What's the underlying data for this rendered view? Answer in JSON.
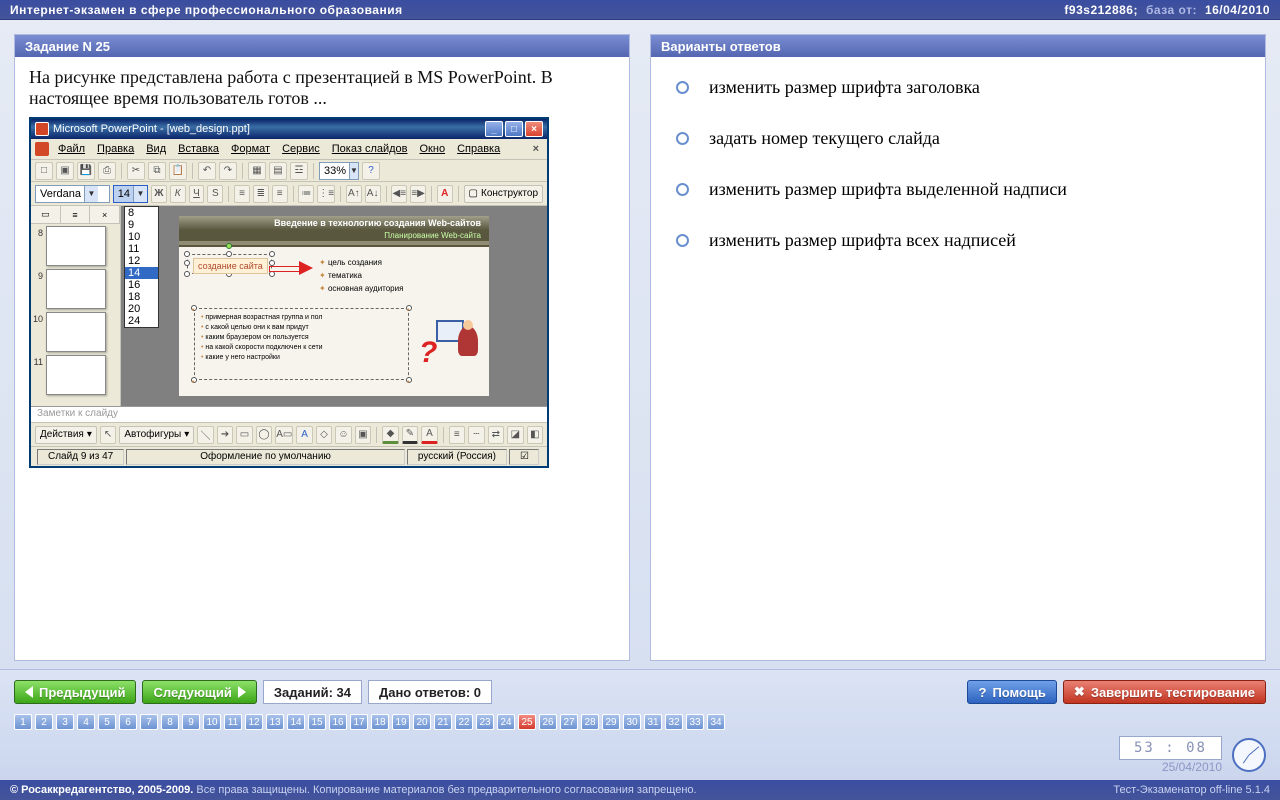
{
  "top": {
    "title": "Интернет-экзамен в сфере профессионального образования",
    "session": "f93s212886;",
    "db_label": "база от:",
    "db_date": "16/04/2010"
  },
  "task": {
    "header": "Задание N 25",
    "text": "На рисунке представлена работа с презентацией в MS PowerPoint. В настоящее время пользователь готов ..."
  },
  "answers_header": "Варианты ответов",
  "answers": [
    "изменить размер шрифта заголовка",
    "задать номер текущего слайда",
    "изменить размер шрифта выделенной надписи",
    "изменить размер шрифта всех надписей"
  ],
  "pp": {
    "title": "Microsoft PowerPoint - [web_design.ppt]",
    "menu": [
      "Файл",
      "Правка",
      "Вид",
      "Вставка",
      "Формат",
      "Сервис",
      "Показ слайдов",
      "Окно",
      "Справка"
    ],
    "font": "Verdana",
    "size_selected": "14",
    "size_list": [
      "8",
      "9",
      "10",
      "11",
      "12",
      "14",
      "16",
      "18",
      "20",
      "24"
    ],
    "zoom": "33%",
    "designer": "Конструктор",
    "thumbs": [
      "8",
      "9",
      "10",
      "11"
    ],
    "slide_title1": "Введение в технологию создания Web-сайтов",
    "slide_title2": "Планирование Web-сайта",
    "sel_label": "создание сайта",
    "bul1": [
      "цель создания",
      "тематика",
      "основная аудитория"
    ],
    "bul2": [
      "примерная возрастная группа и пол",
      "с какой целью они к вам придут",
      "каким браузером он пользуется",
      "на какой скорости подключен к сети",
      "какие у него настройки"
    ],
    "notes": "Заметки к слайду",
    "actions": "Действия",
    "autoshapes": "Автофигуры",
    "status_slide": "Слайд 9 из 47",
    "status_theme": "Оформление по умолчанию",
    "status_lang": "русский (Россия)"
  },
  "nav": {
    "prev": "Предыдущий",
    "next": "Следующий",
    "total_label": "Заданий: 34",
    "answered_label": "Дано ответов: 0",
    "help": "Помощь",
    "finish": "Завершить тестирование",
    "count": 34,
    "active": 25,
    "time": "53 : 08",
    "date": "25/04/2010"
  },
  "footer": {
    "copy": "© Росаккредагентство, 2005-2009.",
    "rights": "Все права защищены. Копирование материалов без предварительного согласования запрещено.",
    "app": "Тест-Экзаменатор off-line 5.1.4"
  }
}
